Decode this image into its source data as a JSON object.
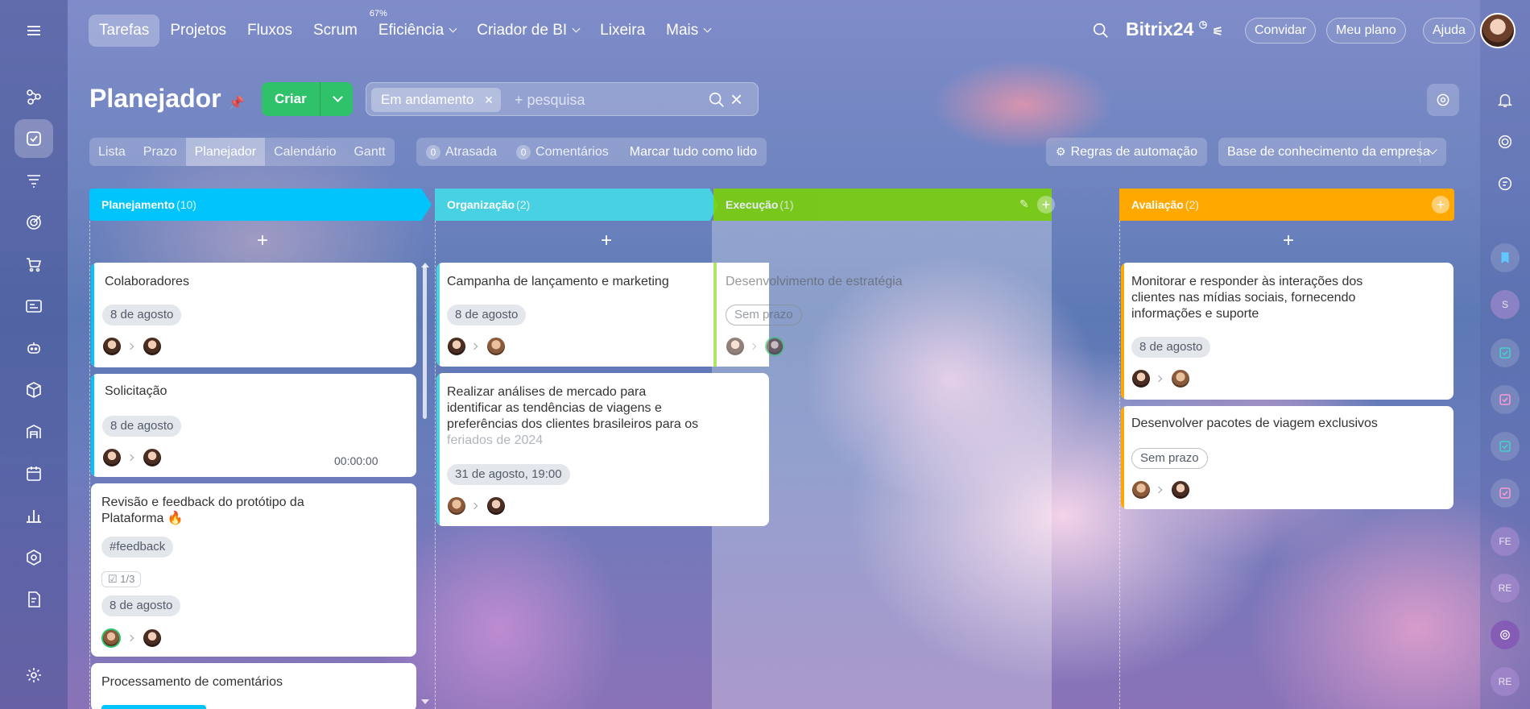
{
  "nav": {
    "items": [
      {
        "label": "Tarefas",
        "active": true
      },
      {
        "label": "Projetos"
      },
      {
        "label": "Fluxos"
      },
      {
        "label": "Scrum"
      },
      {
        "label": "Eficiência",
        "badge": "67%",
        "dropdown": true
      },
      {
        "label": "Criador de BI",
        "dropdown": true
      },
      {
        "label": "Lixeira"
      },
      {
        "label": "Mais",
        "dropdown": true
      }
    ],
    "logo_text": "Bitrix",
    "logo_num": "24",
    "invite": "Convidar",
    "plan": "Meu plano",
    "help": "Ajuda"
  },
  "page": {
    "title": "Planejador",
    "create": "Criar",
    "filter_tag": "Em andamento",
    "search_placeholder": "+ pesquisa"
  },
  "views": [
    "Lista",
    "Prazo",
    "Planejador",
    "Calendário",
    "Gantt"
  ],
  "active_view": "Planejador",
  "counters": {
    "overdue_count": "0",
    "overdue_label": "Atrasada",
    "comments_count": "0",
    "comments_label": "Comentários",
    "mark_all": "Marcar tudo como lido"
  },
  "automation": "Regras de automação",
  "knowledge_base": "Base de conhecimento da empresa",
  "columns": [
    {
      "name": "Planejamento",
      "count": "(10)",
      "color": "#00c4fb"
    },
    {
      "name": "Organização",
      "count": "(2)",
      "color": "#47d1e2"
    },
    {
      "name": "Execução",
      "count": "(1)",
      "color": "#7bd500"
    },
    {
      "name": "Avaliação",
      "count": "(2)",
      "color": "#ffa900"
    }
  ],
  "cards": {
    "c1": {
      "title": "Colaboradores",
      "tag": "8 de agosto"
    },
    "c2": {
      "title": "Solicitação",
      "tag": "8 de agosto",
      "timer": "00:00:00"
    },
    "c3": {
      "title1": "Revisão e feedback do protótipo da",
      "title2": "Plataforma 🔥",
      "hashtag": "#feedback",
      "checklist": "1/3",
      "tag": "8 de agosto"
    },
    "c4": {
      "title": "Processamento de comentários"
    },
    "o1": {
      "title": "Campanha de lançamento e marketing",
      "tag": "8 de agosto"
    },
    "o2": {
      "title1": "Realizar análises de mercado para",
      "title2": "identificar as tendências de viagens e",
      "title3": "preferências dos clientes brasileiros para os",
      "title4": "feriados de 2024",
      "tag": "31 de agosto, 19:00"
    },
    "e1": {
      "title": "Desenvolvimento de estratégia",
      "tag": "Sem prazo"
    },
    "a1": {
      "title1": "Monitorar e responder às interações dos",
      "title2": "clientes nas mídias sociais, fornecendo",
      "title3": "informações e suporte",
      "tag": "8 de agosto"
    },
    "a2": {
      "title": "Desenvolver pacotes de viagem exclusivos",
      "tag": "Sem prazo"
    }
  },
  "rightbar": {
    "s": "S",
    "fe": "FE",
    "re": "RE",
    "re2": "RE"
  }
}
